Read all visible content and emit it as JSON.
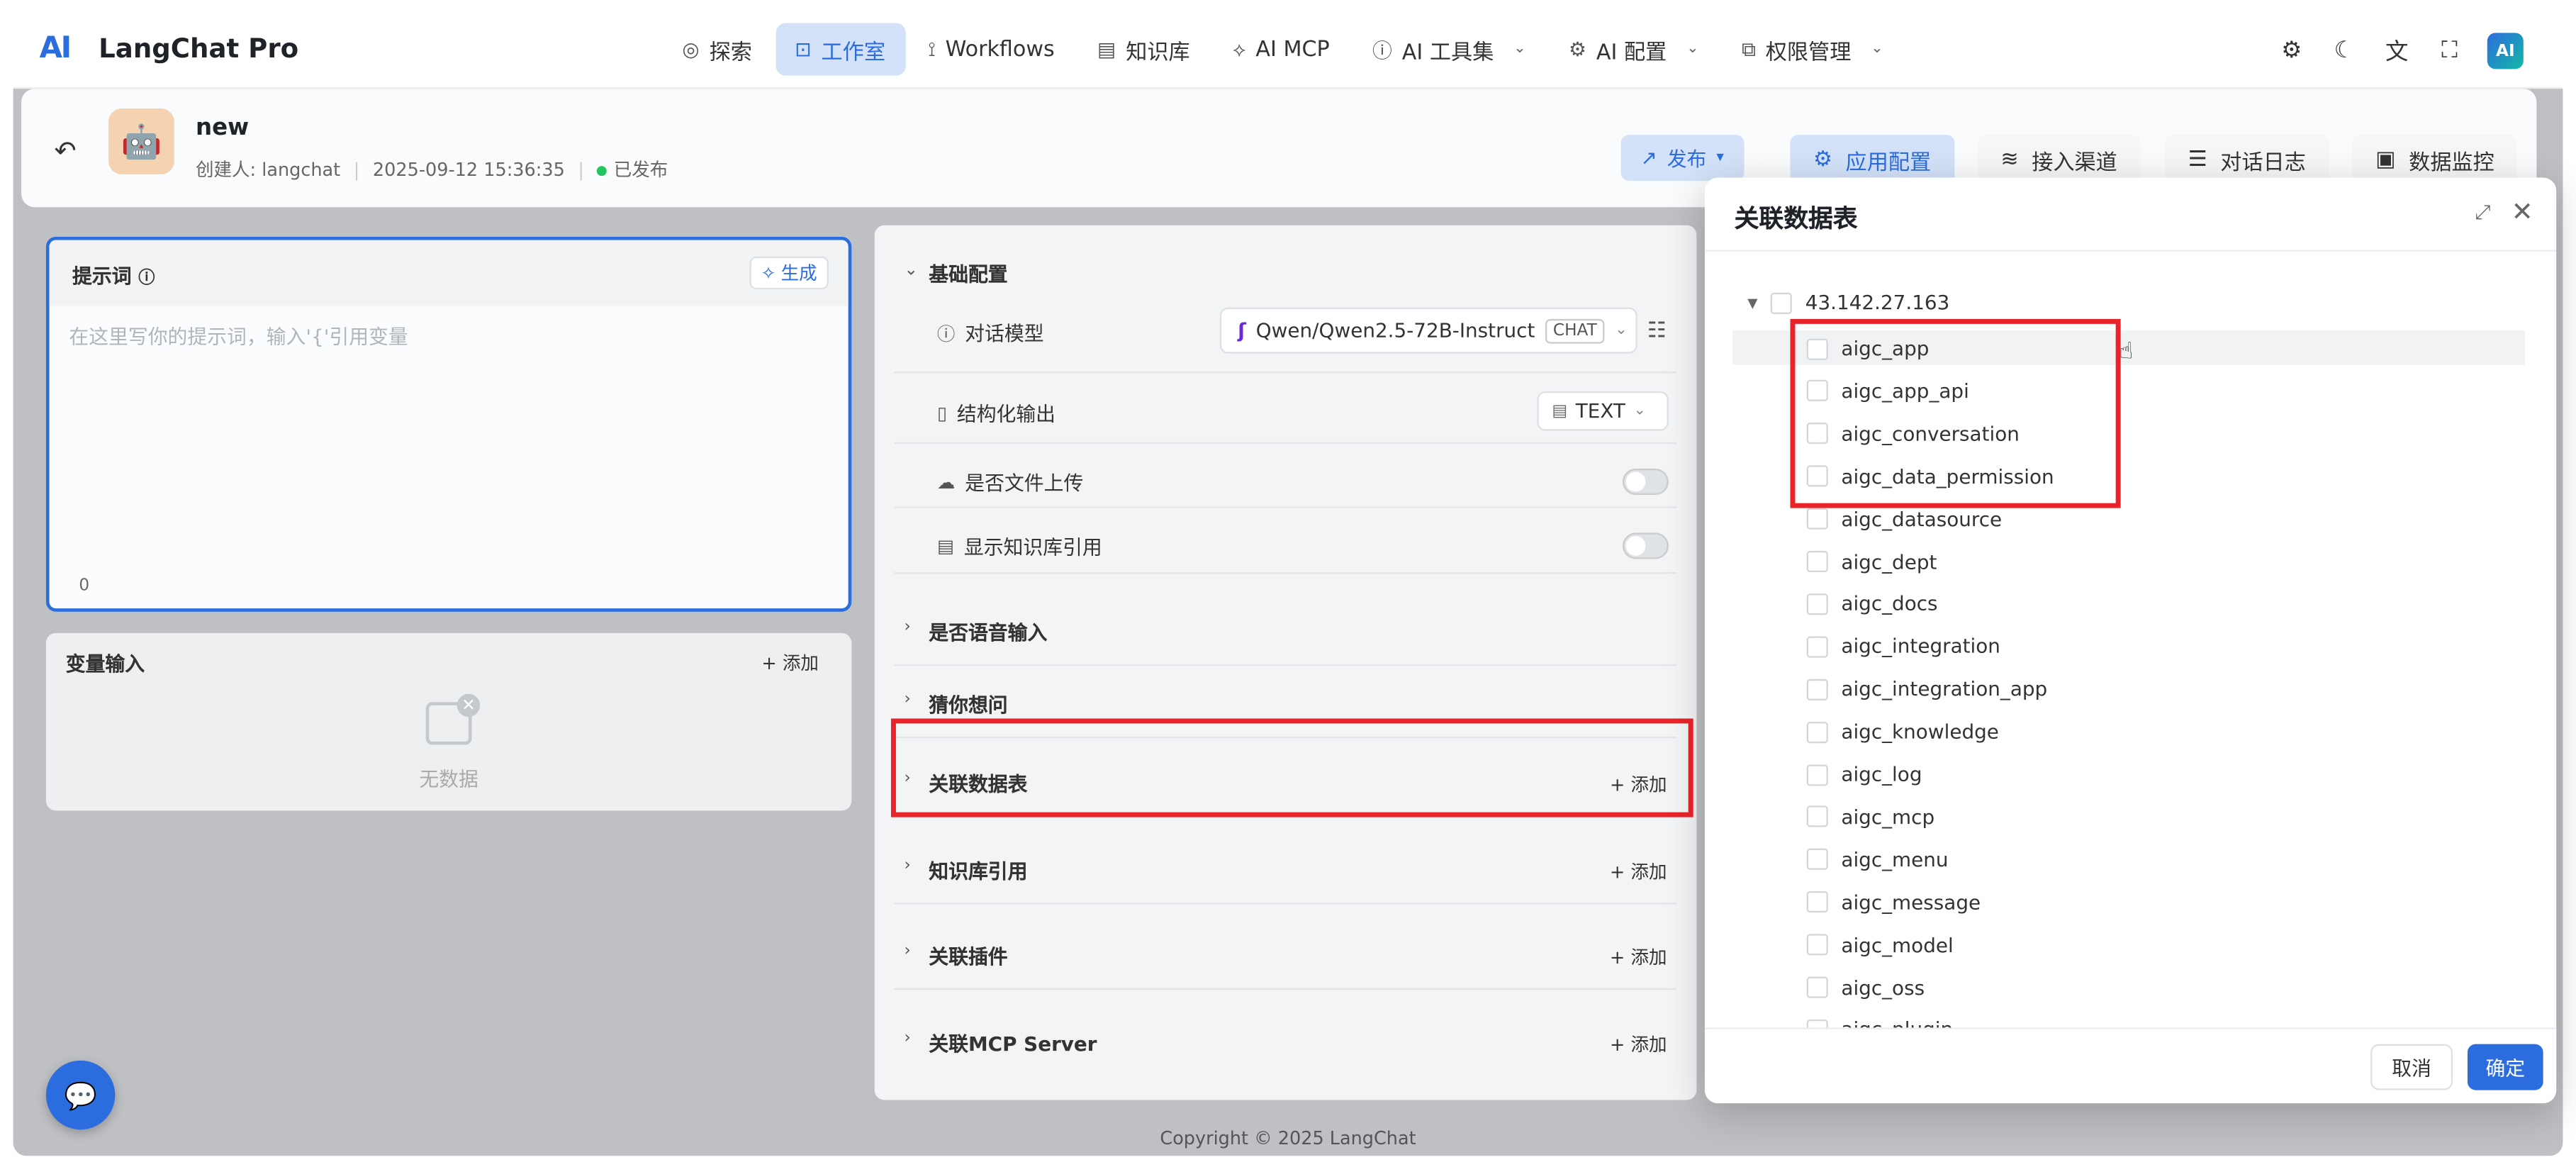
{
  "app": {
    "logo": "AI",
    "brand": "LangChat Pro"
  },
  "nav": [
    {
      "label": "探索",
      "icon": "compass-icon",
      "glyph": "◎",
      "caret": false,
      "active": false
    },
    {
      "label": "工作室",
      "icon": "robot-icon",
      "glyph": "⊡",
      "caret": false,
      "active": true
    },
    {
      "label": "Workflows",
      "icon": "workflow-icon",
      "glyph": "⟟",
      "caret": false,
      "active": false
    },
    {
      "label": "知识库",
      "icon": "book-icon",
      "glyph": "▤",
      "caret": false,
      "active": false
    },
    {
      "label": "AI MCP",
      "icon": "mcp-icon",
      "glyph": "⟡",
      "caret": false,
      "active": false
    },
    {
      "label": "AI 工具集",
      "icon": "tool-icon",
      "glyph": "ⓘ",
      "caret": true,
      "active": false
    },
    {
      "label": "AI 配置",
      "icon": "gear-icon",
      "glyph": "⚙",
      "caret": true,
      "active": false
    },
    {
      "label": "权限管理",
      "icon": "permission-icon",
      "glyph": "⧉",
      "caret": true,
      "active": false
    }
  ],
  "top_right": {
    "settings_glyph": "⚙",
    "theme_glyph": "☾",
    "translate_glyph": "文",
    "fullscreen_glyph": "⛶",
    "avatar": "AI"
  },
  "header": {
    "back_glyph": "↶",
    "app_avatar_glyph": "🤖",
    "app_name": "new",
    "creator_label": "创建人:",
    "creator": "langchat",
    "created_at": "2025-09-12 15:36:35",
    "status": "已发布",
    "publish_label": "发布",
    "buttons": [
      {
        "label": "应用配置",
        "icon": "gear-icon",
        "glyph": "⚙",
        "active": true
      },
      {
        "label": "接入渠道",
        "icon": "signal-icon",
        "glyph": "≋",
        "active": false
      },
      {
        "label": "对话日志",
        "icon": "log-icon",
        "glyph": "☰",
        "active": false
      },
      {
        "label": "数据监控",
        "icon": "monitor-icon",
        "glyph": "▣",
        "active": false
      }
    ]
  },
  "prompt": {
    "title": "提示词",
    "generate_label": "生成",
    "placeholder": "在这里写你的提示词，输入'{'引用变量",
    "count": "0"
  },
  "variables": {
    "title": "变量输入",
    "add_label": "+ 添加",
    "empty_text": "无数据"
  },
  "config": {
    "basic_title": "基础配置",
    "model_label": "对话模型",
    "model_value": "Qwen/Qwen2.5-72B-Instruct",
    "model_tag": "CHAT",
    "structured_label": "结构化输出",
    "structured_value": "TEXT",
    "upload_label": "是否文件上传",
    "kb_ref_label": "显示知识库引用",
    "sections": [
      {
        "title": "是否语音输入",
        "add": ""
      },
      {
        "title": "猜你想问",
        "add": ""
      },
      {
        "title": "关联数据表",
        "add": "+ 添加"
      },
      {
        "title": "知识库引用",
        "add": "+ 添加"
      },
      {
        "title": "关联插件",
        "add": "+ 添加"
      },
      {
        "title": "关联MCP Server",
        "add": "+ 添加"
      }
    ]
  },
  "modal": {
    "title": "关联数据表",
    "root": "43.142.27.163",
    "tables": [
      "aigc_app",
      "aigc_app_api",
      "aigc_conversation",
      "aigc_data_permission",
      "aigc_datasource",
      "aigc_dept",
      "aigc_docs",
      "aigc_integration",
      "aigc_integration_app",
      "aigc_knowledge",
      "aigc_log",
      "aigc_mcp",
      "aigc_menu",
      "aigc_message",
      "aigc_model",
      "aigc_oss",
      "aigc_plugin"
    ],
    "cancel_label": "取消",
    "ok_label": "确定"
  },
  "footer": {
    "copyright": "Copyright © 2025 LangChat"
  },
  "colors": {
    "accent": "#2b6cde",
    "highlight": "#e8242a",
    "status_green": "#22c55e"
  }
}
